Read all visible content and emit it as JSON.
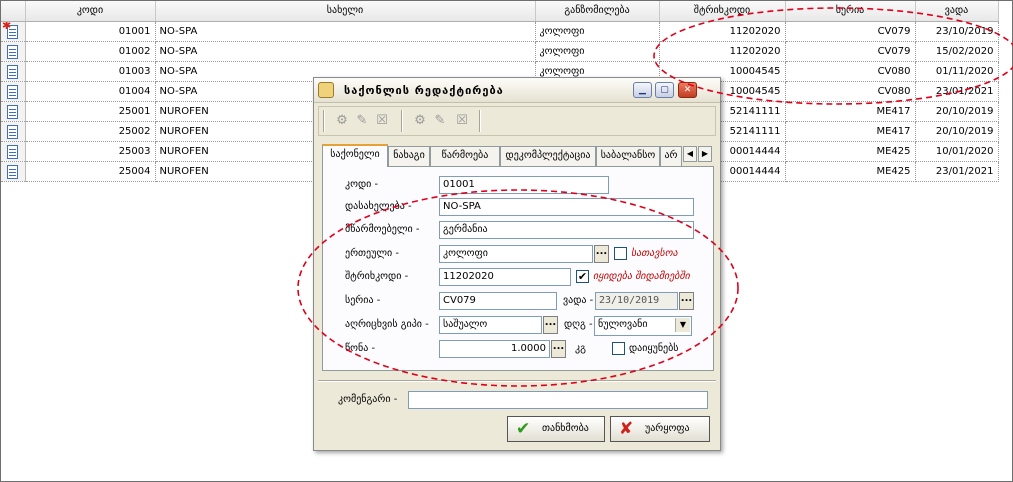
{
  "grid": {
    "columns": [
      "კოდი",
      "სახელი",
      "განზომილება",
      "შტრიხკოდი",
      "სერია",
      "ვადა"
    ],
    "rows": [
      {
        "marker": "star",
        "code": "01001",
        "name": "NO-SPA",
        "unit": "კოლოფი",
        "barcode": "11202020",
        "series": "CV079",
        "date": "23/10/2019"
      },
      {
        "marker": "",
        "code": "01002",
        "name": "NO-SPA",
        "unit": "კოლოფი",
        "barcode": "11202020",
        "series": "CV079",
        "date": "15/02/2020"
      },
      {
        "marker": "",
        "code": "01003",
        "name": "NO-SPA",
        "unit": "კოლოფი",
        "barcode": "10004545",
        "series": "CV080",
        "date": "01/11/2020"
      },
      {
        "marker": "",
        "code": "01004",
        "name": "NO-SPA",
        "unit": "კოლოფი",
        "barcode": "10004545",
        "series": "CV080",
        "date": "23/01/2021"
      },
      {
        "marker": "",
        "code": "25001",
        "name": "NUROFEN",
        "unit": "",
        "barcode": "52141111",
        "series": "ME417",
        "date": "20/10/2019"
      },
      {
        "marker": "",
        "code": "25002",
        "name": "NUROFEN",
        "unit": "",
        "barcode": "52141111",
        "series": "ME417",
        "date": "20/10/2019"
      },
      {
        "marker": "",
        "code": "25003",
        "name": "NUROFEN",
        "unit": "",
        "barcode": "00014444",
        "series": "ME425",
        "date": "10/01/2020"
      },
      {
        "marker": "",
        "code": "25004",
        "name": "NUROFEN",
        "unit": "",
        "barcode": "00014444",
        "series": "ME425",
        "date": "23/01/2021"
      }
    ]
  },
  "dialog": {
    "title": "საქონლის რედაქტირება",
    "tabs": [
      "საქონელი",
      "ნახაგი",
      "წარმოება",
      "დეკომპლექტაცია",
      "საბალანსო",
      "არ"
    ],
    "labels": {
      "code": "კოდი -",
      "name": "დასახელება -",
      "manufacturer": "მწარმოებელი -",
      "unit": "ერთეული -",
      "barcode": "შტრიხკოდი -",
      "series": "სერია -",
      "expiry": "ვადა -",
      "accounting": "აღრიცხვის გიპი -",
      "vat": "დღგ -",
      "weight": "წონა -",
      "weight_unit": "კგ",
      "comment": "კომენგარი -"
    },
    "values": {
      "code": "01001",
      "name": "NO-SPA",
      "manufacturer": "გერმანია",
      "unit": "კოლოფი",
      "barcode": "11202020",
      "series": "CV079",
      "expiry": "23/10/2019",
      "accounting": "საშუალო",
      "vat": "ნულოვანი",
      "weight": "1.0000",
      "comment": ""
    },
    "checks": {
      "service_label": "სათავსოა",
      "service": false,
      "match_label": "იყიდება შიდამიებში",
      "match": true,
      "dividable_label": "დაიყუნებს",
      "dividable": false
    },
    "buttons": {
      "ok": "თანხმობა",
      "cancel": "უარყოფა"
    }
  },
  "colors": {
    "highlight_red": "#e0001a",
    "active_tab": "#e6a234"
  }
}
